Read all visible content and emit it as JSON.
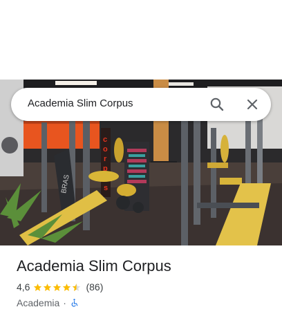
{
  "search": {
    "value": "Academia Slim Corpus",
    "search_icon": "search-icon",
    "close_icon": "close-icon"
  },
  "place": {
    "name": "Academia Slim Corpus",
    "rating": "4,6",
    "rating_value": 4.6,
    "reviews": "(86)",
    "category": "Academia",
    "separator": "·",
    "accessibility_icon": "wheelchair-icon"
  },
  "photo": {
    "sign_letters": [
      "c",
      "o",
      "r",
      "p",
      "u",
      "s"
    ],
    "bench_label": "BRAS"
  },
  "colors": {
    "star": "#fbbc04",
    "accessibility": "#1a73e8",
    "text_primary": "#202124",
    "text_secondary": "#5f6368"
  }
}
